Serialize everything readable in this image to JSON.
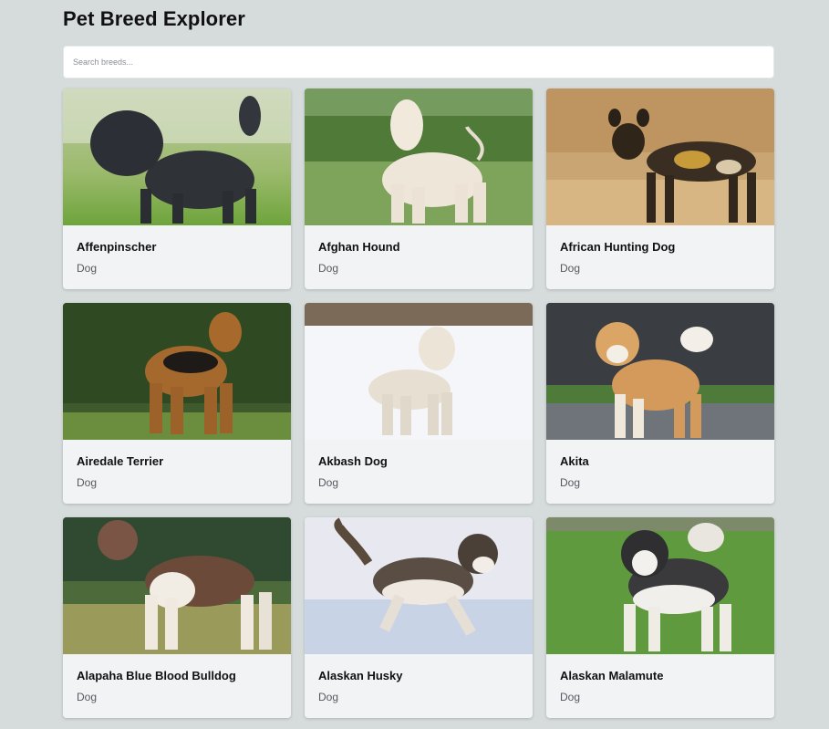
{
  "header": {
    "title": "Pet Breed Explorer"
  },
  "search": {
    "placeholder": "Search breeds...",
    "value": ""
  },
  "breeds": [
    {
      "name": "Affenpinscher",
      "type": "Dog"
    },
    {
      "name": "Afghan Hound",
      "type": "Dog"
    },
    {
      "name": "African Hunting Dog",
      "type": "Dog"
    },
    {
      "name": "Airedale Terrier",
      "type": "Dog"
    },
    {
      "name": "Akbash Dog",
      "type": "Dog"
    },
    {
      "name": "Akita",
      "type": "Dog"
    },
    {
      "name": "Alapaha Blue Blood Bulldog",
      "type": "Dog"
    },
    {
      "name": "Alaskan Husky",
      "type": "Dog"
    },
    {
      "name": "Alaskan Malamute",
      "type": "Dog"
    }
  ],
  "colors": {
    "page_background": "#d6dbdb",
    "card_background": "#f2f3f5",
    "title_text": "#111111",
    "secondary_text": "#555a60"
  }
}
